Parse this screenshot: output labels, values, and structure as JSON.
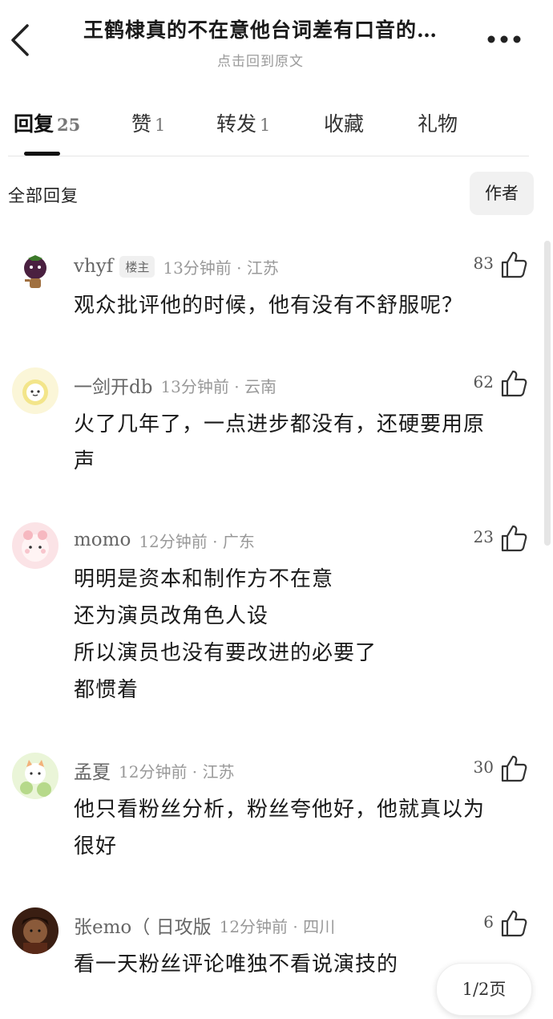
{
  "header": {
    "title": "王鹤棣真的不在意他台词差有口音的…",
    "subtitle": "点击回到原文"
  },
  "tabs": [
    {
      "label": "回复",
      "count": "25"
    },
    {
      "label": "赞",
      "count": "1"
    },
    {
      "label": "转发",
      "count": "1"
    },
    {
      "label": "收藏",
      "count": ""
    },
    {
      "label": "礼物",
      "count": ""
    }
  ],
  "filter": {
    "section_label": "全部回复",
    "author_button": "作者"
  },
  "comments": [
    {
      "username": "vhyf",
      "badge": "楼主",
      "time": "13分钟前 · 江苏",
      "likes": "83",
      "lines": [
        "观众批评他的时候，他有没有不舒服呢？"
      ]
    },
    {
      "username": "一剑开db",
      "badge": "",
      "time": "13分钟前 · 云南",
      "likes": "62",
      "lines": [
        "火了几年了，一点进步都没有，还硬要用原",
        "声"
      ]
    },
    {
      "username": "momo",
      "badge": "",
      "time": "12分钟前 · 广东",
      "likes": "23",
      "lines": [
        "明明是资本和制作方不在意",
        "还为演员改角色人设",
        "所以演员也没有要改进的必要了",
        "都惯着"
      ]
    },
    {
      "username": "孟夏",
      "badge": "",
      "time": "12分钟前 · 江苏",
      "likes": "30",
      "lines": [
        "他只看粉丝分析，粉丝夸他好，他就真以为",
        "很好"
      ]
    },
    {
      "username": "张emo（ 日攻版",
      "badge": "",
      "time": "12分钟前 · 四川",
      "likes": "6",
      "lines": [
        "看一天粉丝评论唯独不看说演技的"
      ]
    }
  ],
  "pager": {
    "label": "1/2页"
  },
  "colors": {
    "background": "#ffffff",
    "text": "#1a1a1a",
    "meta": "#999999",
    "badge_bg": "#f0f0f0"
  },
  "icons": [
    "back-arrow-icon",
    "more-dots-icon",
    "thumbs-up-icon"
  ]
}
